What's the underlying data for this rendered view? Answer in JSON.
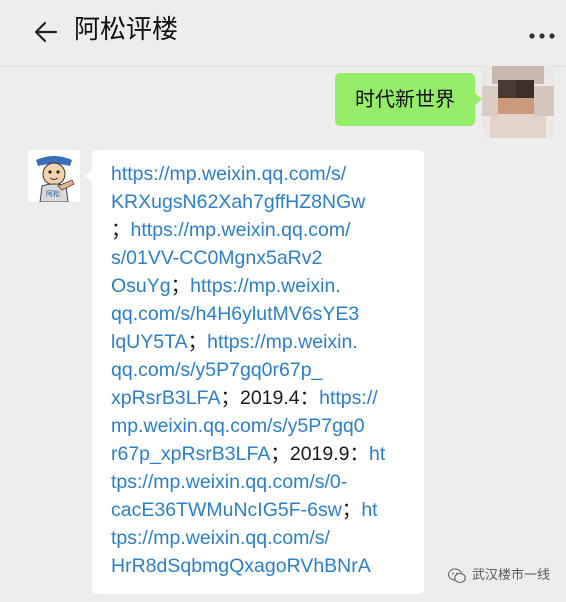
{
  "header": {
    "title": "阿松评楼",
    "back_icon": "back-arrow-icon",
    "more_icon": "more-dots-icon"
  },
  "messages": {
    "sent": {
      "text": "时代新世界"
    },
    "received": {
      "lines": [
        [
          {
            "t": "https://mp.weixin.qq.com/s/",
            "link": true
          }
        ],
        [
          {
            "t": "KRXugsN62Xah7gffHZ8NGw",
            "link": true
          }
        ],
        [
          {
            "t": "；",
            "link": false
          },
          {
            "t": "https://mp.weixin.qq.com/",
            "link": true
          }
        ],
        [
          {
            "t": "s/01VV-CC0Mgnx5aRv2",
            "link": true
          }
        ],
        [
          {
            "t": "OsuYg",
            "link": true
          },
          {
            "t": "；",
            "link": false
          },
          {
            "t": "https://mp.weixin.",
            "link": true
          }
        ],
        [
          {
            "t": "qq.com/s/h4H6ylutMV6sYE3",
            "link": true
          }
        ],
        [
          {
            "t": "lqUY5TA",
            "link": true
          },
          {
            "t": "；",
            "link": false
          },
          {
            "t": "https://mp.weixin.",
            "link": true
          }
        ],
        [
          {
            "t": "qq.com/s/y5P7gq0r67p_",
            "link": true
          }
        ],
        [
          {
            "t": "xpRsrB3LFA",
            "link": true
          },
          {
            "t": "；2019.4：",
            "link": false
          },
          {
            "t": "https://",
            "link": true
          }
        ],
        [
          {
            "t": "mp.weixin.qq.com/s/y5P7gq0",
            "link": true
          }
        ],
        [
          {
            "t": "r67p_xpRsrB3LFA",
            "link": true
          },
          {
            "t": "；2019.9：",
            "link": false
          },
          {
            "t": "ht",
            "link": true
          }
        ],
        [
          {
            "t": "tps://mp.weixin.qq.com/s/0-",
            "link": true
          }
        ],
        [
          {
            "t": "cacE36TWMuNcIG5F-6sw",
            "link": true
          },
          {
            "t": "；",
            "link": false
          },
          {
            "t": "ht",
            "link": true
          }
        ],
        [
          {
            "t": "tps://mp.weixin.qq.com/s/",
            "link": true
          }
        ],
        [
          {
            "t": "HrR8dSqbmgQxagoRVhBNrA",
            "link": true
          }
        ]
      ]
    }
  },
  "watermark": {
    "text": "武汉楼市一线",
    "icon": "wechat-icon"
  },
  "colors": {
    "background": "#ededed",
    "sent_bubble": "#95ec69",
    "received_bubble": "#ffffff",
    "link": "#2b7fc9"
  }
}
